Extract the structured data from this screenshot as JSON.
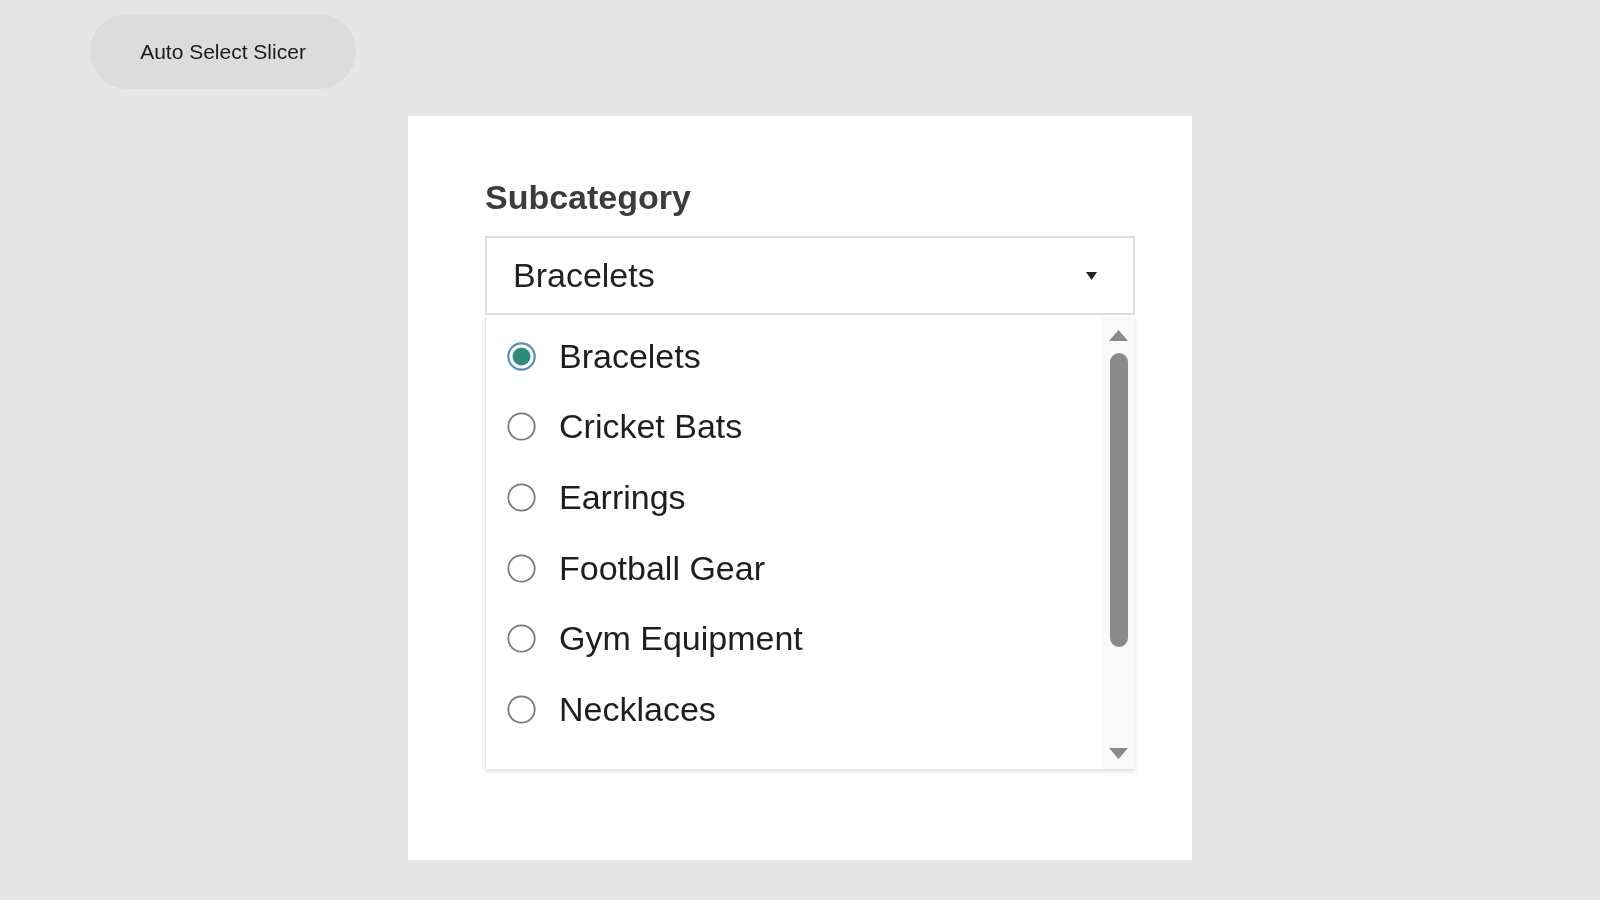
{
  "top_button": {
    "label": "Auto Select Slicer"
  },
  "slicer": {
    "title": "Subcategory",
    "dropdown": {
      "value": "Bracelets",
      "expanded": true
    },
    "options": [
      {
        "label": "Bracelets",
        "selected": true
      },
      {
        "label": "Cricket Bats",
        "selected": false
      },
      {
        "label": "Earrings",
        "selected": false
      },
      {
        "label": "Football Gear",
        "selected": false
      },
      {
        "label": "Gym Equipment",
        "selected": false
      },
      {
        "label": "Necklaces",
        "selected": false
      }
    ]
  }
}
